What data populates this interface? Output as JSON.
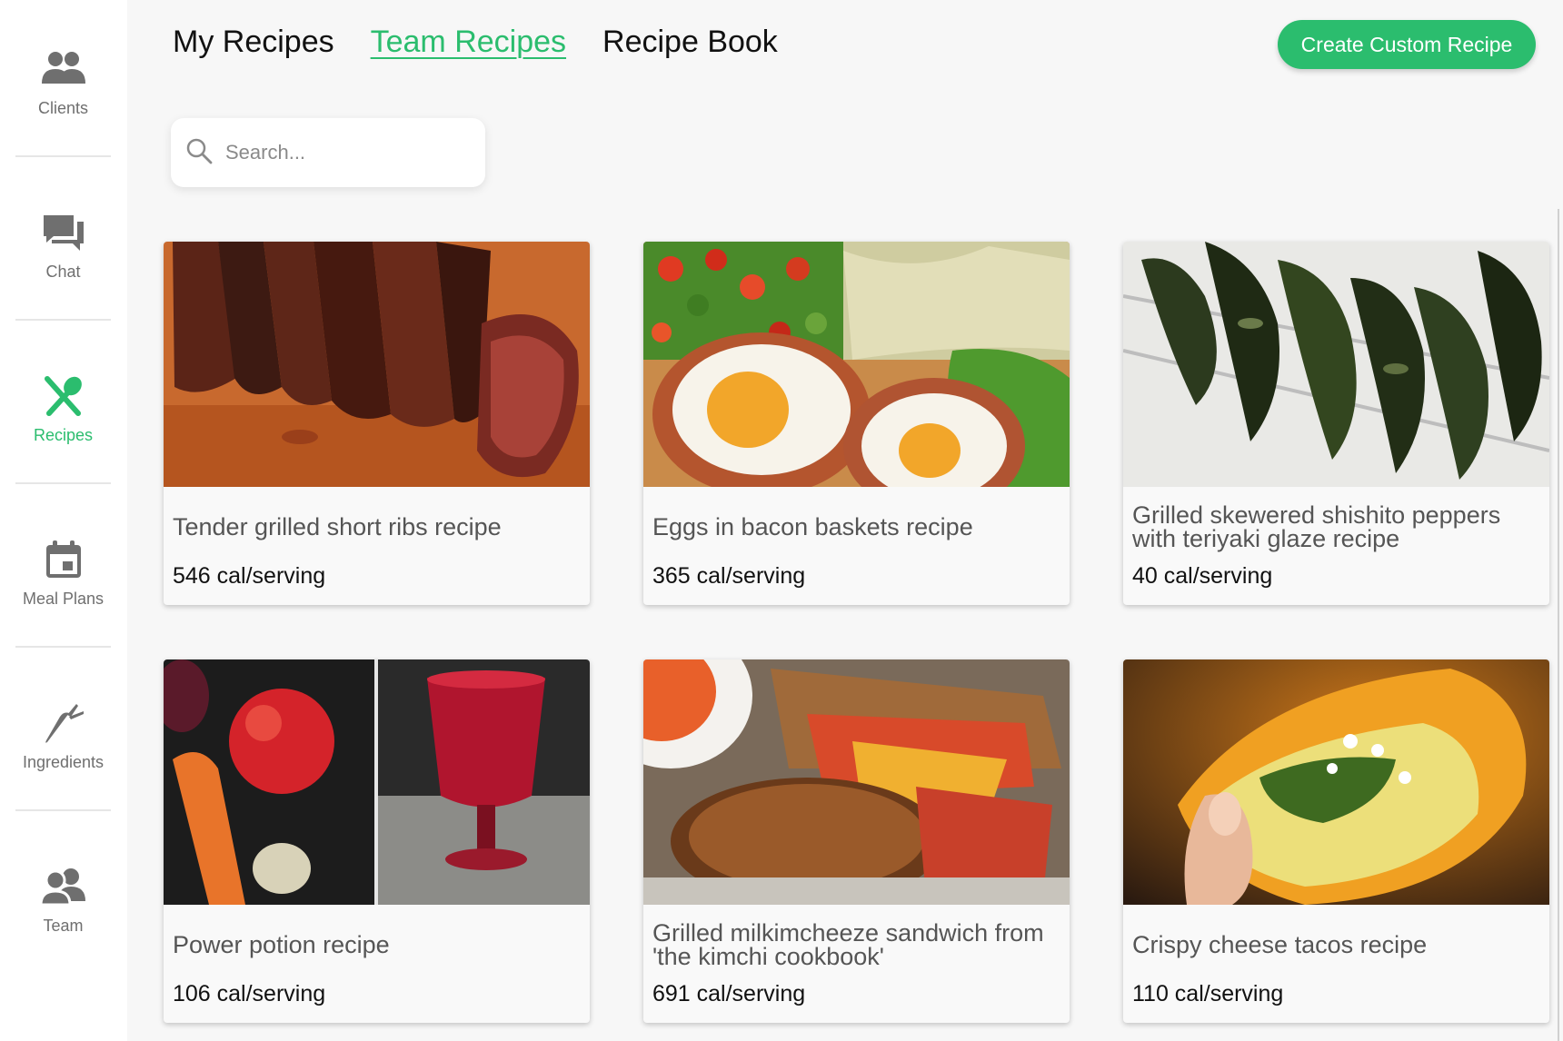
{
  "sidebar": {
    "items": [
      {
        "label": "Clients",
        "icon": "clients-icon",
        "active": false
      },
      {
        "label": "Chat",
        "icon": "chat-icon",
        "active": false
      },
      {
        "label": "Recipes",
        "icon": "recipes-icon",
        "active": true
      },
      {
        "label": "Meal Plans",
        "icon": "calendar-icon",
        "active": false
      },
      {
        "label": "Ingredients",
        "icon": "carrot-icon",
        "active": false
      },
      {
        "label": "Team",
        "icon": "team-icon",
        "active": false
      }
    ]
  },
  "header": {
    "tabs": [
      {
        "label": "My Recipes",
        "active": false
      },
      {
        "label": "Team Recipes",
        "active": true
      },
      {
        "label": "Recipe Book",
        "active": false
      }
    ],
    "create_button": "Create Custom Recipe"
  },
  "search": {
    "placeholder": "Search..."
  },
  "recipes": [
    {
      "title": "Tender grilled short ribs recipe",
      "calories": "546 cal/serving",
      "image": "grilled short ribs"
    },
    {
      "title": "Eggs in bacon baskets recipe",
      "calories": "365 cal/serving",
      "image": "eggs in bacon baskets"
    },
    {
      "title": "Grilled skewered shishito peppers with teriyaki glaze recipe",
      "calories": "40 cal/serving",
      "image": "shishito peppers"
    },
    {
      "title": "Power potion recipe",
      "calories": "106 cal/serving",
      "image": "beet juice and produce"
    },
    {
      "title": "Grilled milkimcheeze sandwich from 'the kimchi cookbook'",
      "calories": "691 cal/serving",
      "image": "kimchi grilled cheese"
    },
    {
      "title": "Crispy cheese tacos recipe",
      "calories": "110 cal/serving",
      "image": "cheese taco"
    }
  ],
  "colors": {
    "accent": "#2bbd6e",
    "icon_gray": "#6f6f6f",
    "background": "#f7f7f7"
  }
}
